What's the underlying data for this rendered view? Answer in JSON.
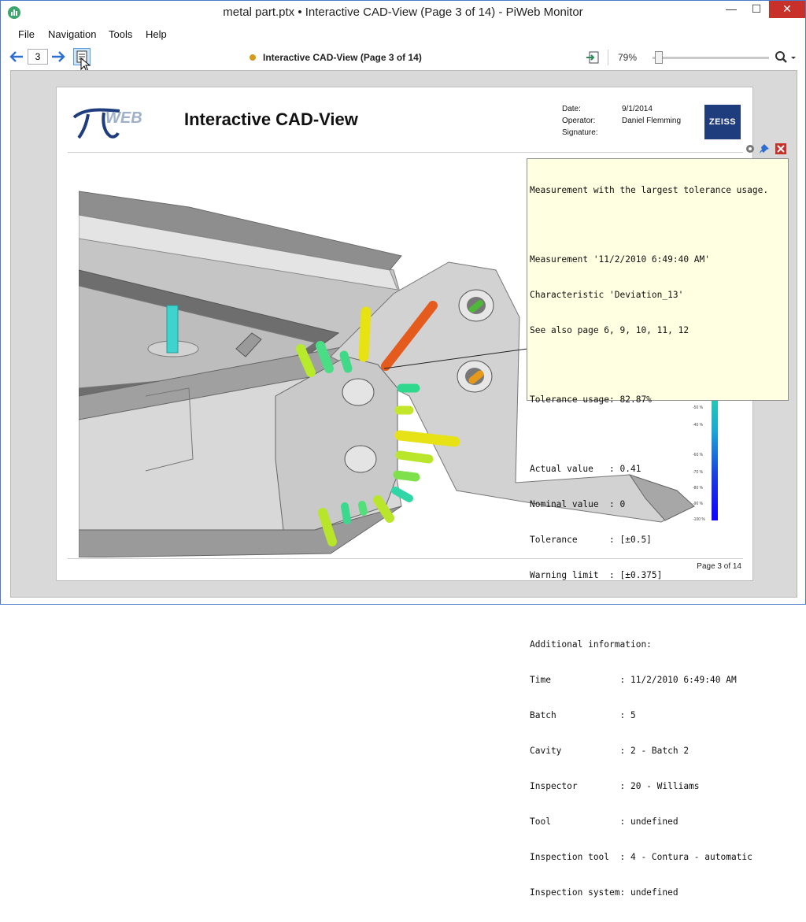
{
  "window": {
    "title": "metal part.ptx • Interactive CAD-View (Page 3 of 14) - PiWeb Monitor",
    "minimize": "—",
    "maximize": "☐",
    "close": "✕"
  },
  "menu": [
    "File",
    "Navigation",
    "Tools",
    "Help"
  ],
  "toolbar": {
    "page_number": "3",
    "doc_title": "Interactive CAD-View (Page 3 of 14)",
    "zoom": "79%",
    "zoom_level": 0.79,
    "status_color": "#d59a1a"
  },
  "report": {
    "logo_text": "WEB",
    "title": "Interactive CAD-View",
    "meta": [
      {
        "label": "Date:",
        "value": "9/1/2014"
      },
      {
        "label": "Operator:",
        "value": "Daniel Flemming"
      },
      {
        "label": "Signature:",
        "value": ""
      }
    ],
    "brand": "ZEISS",
    "footer": "Page 3 of 14",
    "legend_ticks": [
      "-50 %",
      "-40 %",
      "-60 %",
      "-70 %",
      "-80 %",
      "-90 %",
      "-100 %"
    ]
  },
  "tooltip": {
    "lines": [
      "Measurement with the largest tolerance usage.",
      "",
      "Measurement '11/2/2010 6:49:40 AM'",
      "Characteristic 'Deviation_13'",
      "See also page 6, 9, 10, 11, 12",
      "",
      "Tolerance usage: 82.87%",
      "",
      "Actual value   : 0.41",
      "Nominal value  : 0",
      "Tolerance      : [±0.5]",
      "Warning limit  : [±0.375]",
      "",
      "Additional information:",
      "Time             : 11/2/2010 6:49:40 AM",
      "Batch            : 5",
      "Cavity           : 2 - Batch 2",
      "Inspector        : 20 - Williams",
      "Tool             : undefined",
      "Inspection tool  : 4 - Contura - automatic",
      "Inspection system: undefined"
    ]
  },
  "colors": {
    "accent": "#2c6fd1",
    "close_red": "#c7312a",
    "tooltip_bg": "#ffffe1",
    "tol_red": "#e2571c",
    "tol_yellow": "#e9e312",
    "tol_green": "#35d67a",
    "tol_cyan": "#38d3c9"
  }
}
